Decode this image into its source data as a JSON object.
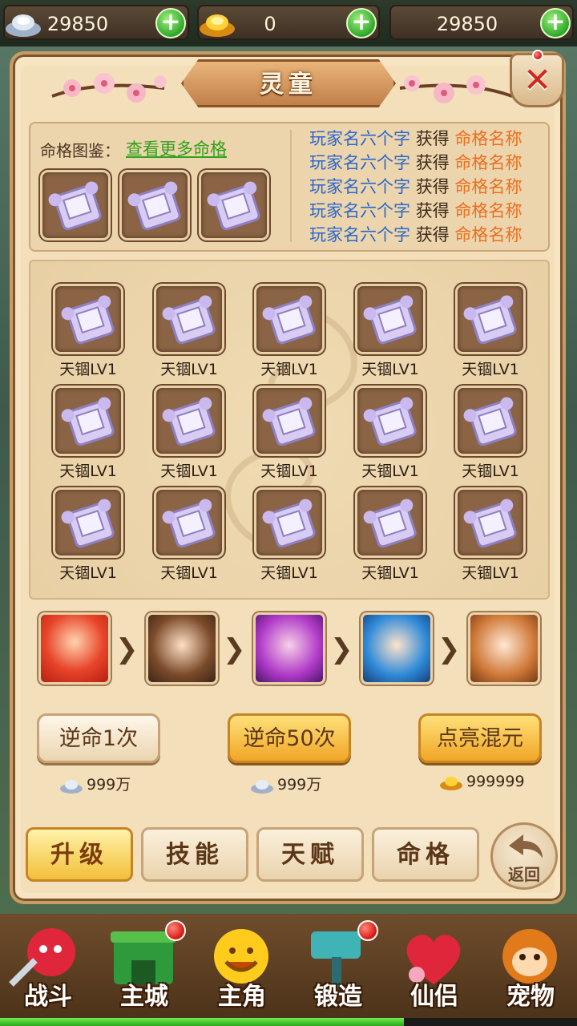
{
  "currency": {
    "silver": "29850",
    "gold": "0",
    "third": "29850"
  },
  "panel": {
    "title": "灵童"
  },
  "atlas": {
    "label": "命格图鉴：",
    "link": "查看更多命格"
  },
  "feed": [
    {
      "player": "玩家名六个字",
      "action": "获得",
      "item": "命格名称"
    },
    {
      "player": "玩家名六个字",
      "action": "获得",
      "item": "命格名称"
    },
    {
      "player": "玩家名六个字",
      "action": "获得",
      "item": "命格名称"
    },
    {
      "player": "玩家名六个字",
      "action": "获得",
      "item": "命格名称"
    },
    {
      "player": "玩家名六个字",
      "action": "获得",
      "item": "命格名称"
    }
  ],
  "grid": {
    "items": [
      "天锢LV1",
      "天锢LV1",
      "天锢LV1",
      "天锢LV1",
      "天锢LV1",
      "天锢LV1",
      "天锢LV1",
      "天锢LV1",
      "天锢LV1",
      "天锢LV1",
      "天锢LV1",
      "天锢LV1",
      "天锢LV1",
      "天锢LV1",
      "天锢LV1"
    ]
  },
  "actions": {
    "once": "逆命1次",
    "fifty": "逆命50次",
    "light": "点亮混元",
    "cost_once": "999万",
    "cost_fifty": "999万",
    "cost_light": "999999"
  },
  "tabs": {
    "upgrade": "升级",
    "skill": "技能",
    "talent": "天赋",
    "fate": "命格",
    "back": "返回"
  },
  "nav": {
    "battle": "战斗",
    "city": "主城",
    "hero": "主角",
    "forge": "锻造",
    "partner": "仙侣",
    "pet": "宠物"
  },
  "progress": 0.7,
  "colors": {
    "player_name": "#2b67c9",
    "item_name": "#ef6e1d",
    "link": "#2fa11c"
  }
}
